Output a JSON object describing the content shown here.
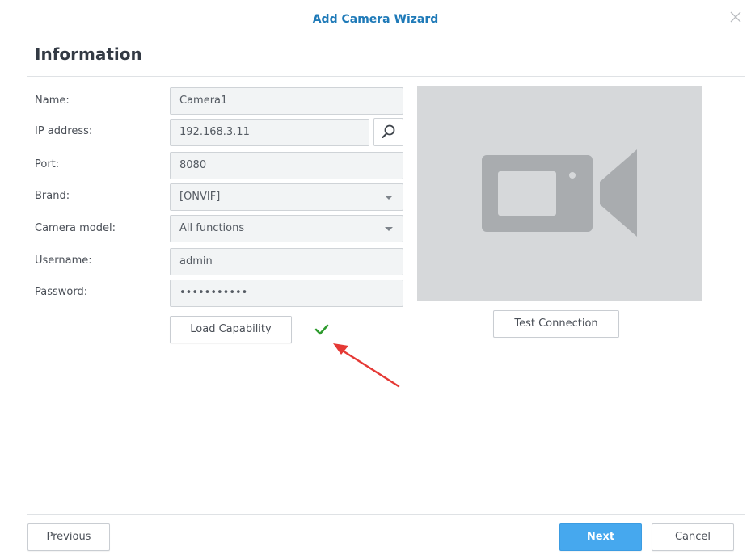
{
  "window": {
    "title": "Add Camera Wizard",
    "close_icon": "close-icon"
  },
  "section": {
    "title": "Information"
  },
  "form": {
    "name": {
      "label": "Name:",
      "value": "Camera1"
    },
    "ip": {
      "label": "IP address:",
      "value": "192.168.3.11"
    },
    "port": {
      "label": "Port:",
      "value": "8080"
    },
    "brand": {
      "label": "Brand:",
      "value": "[ONVIF]"
    },
    "model": {
      "label": "Camera model:",
      "value": "All functions"
    },
    "username": {
      "label": "Username:",
      "value": "admin"
    },
    "password": {
      "label": "Password:",
      "value": "•••••••••••"
    }
  },
  "buttons": {
    "load_capability": "Load Capability",
    "test_connection": "Test Connection",
    "previous": "Previous",
    "next": "Next",
    "cancel": "Cancel"
  },
  "colors": {
    "title": "#1f7ab8",
    "primary_button": "#46a8ee",
    "success_check": "#2e9b2e",
    "annotation_arrow": "#e53935",
    "preview_bg": "#d6d8da",
    "preview_icon": "#a9acaf"
  },
  "icons": {
    "search": "search-icon",
    "camera_placeholder": "video-camera-icon",
    "status": "checkmark-icon",
    "annotation": "red-arrow"
  }
}
